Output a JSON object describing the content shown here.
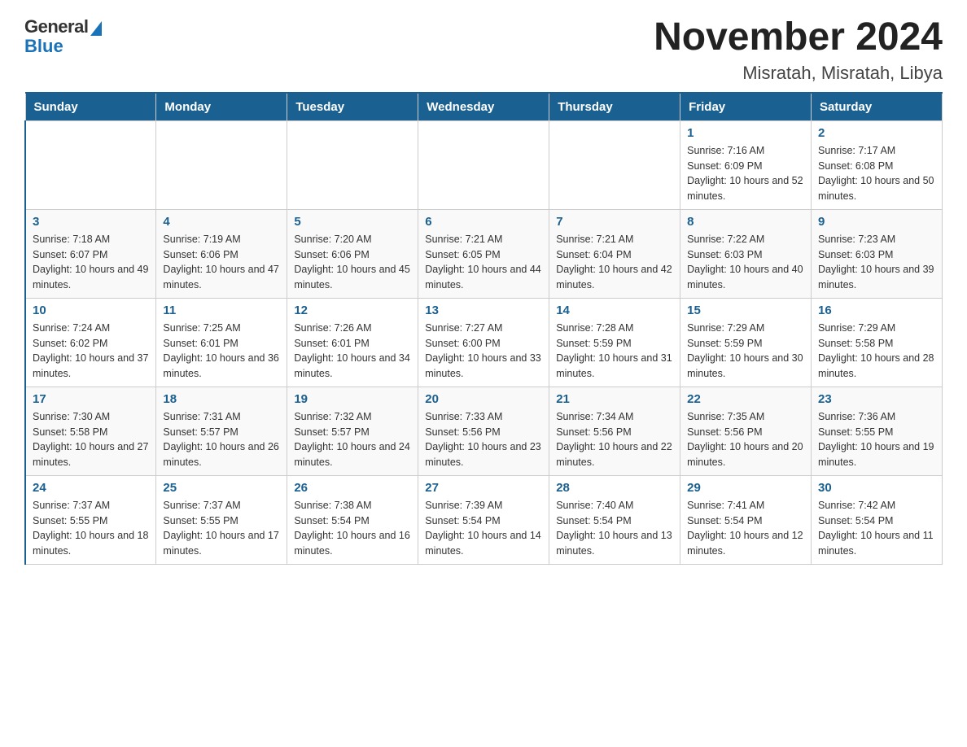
{
  "header": {
    "logo_general": "General",
    "logo_blue": "Blue",
    "month_year": "November 2024",
    "location": "Misratah, Misratah, Libya"
  },
  "days_of_week": [
    "Sunday",
    "Monday",
    "Tuesday",
    "Wednesday",
    "Thursday",
    "Friday",
    "Saturday"
  ],
  "weeks": [
    [
      {
        "day": "",
        "info": ""
      },
      {
        "day": "",
        "info": ""
      },
      {
        "day": "",
        "info": ""
      },
      {
        "day": "",
        "info": ""
      },
      {
        "day": "",
        "info": ""
      },
      {
        "day": "1",
        "info": "Sunrise: 7:16 AM\nSunset: 6:09 PM\nDaylight: 10 hours and 52 minutes."
      },
      {
        "day": "2",
        "info": "Sunrise: 7:17 AM\nSunset: 6:08 PM\nDaylight: 10 hours and 50 minutes."
      }
    ],
    [
      {
        "day": "3",
        "info": "Sunrise: 7:18 AM\nSunset: 6:07 PM\nDaylight: 10 hours and 49 minutes."
      },
      {
        "day": "4",
        "info": "Sunrise: 7:19 AM\nSunset: 6:06 PM\nDaylight: 10 hours and 47 minutes."
      },
      {
        "day": "5",
        "info": "Sunrise: 7:20 AM\nSunset: 6:06 PM\nDaylight: 10 hours and 45 minutes."
      },
      {
        "day": "6",
        "info": "Sunrise: 7:21 AM\nSunset: 6:05 PM\nDaylight: 10 hours and 44 minutes."
      },
      {
        "day": "7",
        "info": "Sunrise: 7:21 AM\nSunset: 6:04 PM\nDaylight: 10 hours and 42 minutes."
      },
      {
        "day": "8",
        "info": "Sunrise: 7:22 AM\nSunset: 6:03 PM\nDaylight: 10 hours and 40 minutes."
      },
      {
        "day": "9",
        "info": "Sunrise: 7:23 AM\nSunset: 6:03 PM\nDaylight: 10 hours and 39 minutes."
      }
    ],
    [
      {
        "day": "10",
        "info": "Sunrise: 7:24 AM\nSunset: 6:02 PM\nDaylight: 10 hours and 37 minutes."
      },
      {
        "day": "11",
        "info": "Sunrise: 7:25 AM\nSunset: 6:01 PM\nDaylight: 10 hours and 36 minutes."
      },
      {
        "day": "12",
        "info": "Sunrise: 7:26 AM\nSunset: 6:01 PM\nDaylight: 10 hours and 34 minutes."
      },
      {
        "day": "13",
        "info": "Sunrise: 7:27 AM\nSunset: 6:00 PM\nDaylight: 10 hours and 33 minutes."
      },
      {
        "day": "14",
        "info": "Sunrise: 7:28 AM\nSunset: 5:59 PM\nDaylight: 10 hours and 31 minutes."
      },
      {
        "day": "15",
        "info": "Sunrise: 7:29 AM\nSunset: 5:59 PM\nDaylight: 10 hours and 30 minutes."
      },
      {
        "day": "16",
        "info": "Sunrise: 7:29 AM\nSunset: 5:58 PM\nDaylight: 10 hours and 28 minutes."
      }
    ],
    [
      {
        "day": "17",
        "info": "Sunrise: 7:30 AM\nSunset: 5:58 PM\nDaylight: 10 hours and 27 minutes."
      },
      {
        "day": "18",
        "info": "Sunrise: 7:31 AM\nSunset: 5:57 PM\nDaylight: 10 hours and 26 minutes."
      },
      {
        "day": "19",
        "info": "Sunrise: 7:32 AM\nSunset: 5:57 PM\nDaylight: 10 hours and 24 minutes."
      },
      {
        "day": "20",
        "info": "Sunrise: 7:33 AM\nSunset: 5:56 PM\nDaylight: 10 hours and 23 minutes."
      },
      {
        "day": "21",
        "info": "Sunrise: 7:34 AM\nSunset: 5:56 PM\nDaylight: 10 hours and 22 minutes."
      },
      {
        "day": "22",
        "info": "Sunrise: 7:35 AM\nSunset: 5:56 PM\nDaylight: 10 hours and 20 minutes."
      },
      {
        "day": "23",
        "info": "Sunrise: 7:36 AM\nSunset: 5:55 PM\nDaylight: 10 hours and 19 minutes."
      }
    ],
    [
      {
        "day": "24",
        "info": "Sunrise: 7:37 AM\nSunset: 5:55 PM\nDaylight: 10 hours and 18 minutes."
      },
      {
        "day": "25",
        "info": "Sunrise: 7:37 AM\nSunset: 5:55 PM\nDaylight: 10 hours and 17 minutes."
      },
      {
        "day": "26",
        "info": "Sunrise: 7:38 AM\nSunset: 5:54 PM\nDaylight: 10 hours and 16 minutes."
      },
      {
        "day": "27",
        "info": "Sunrise: 7:39 AM\nSunset: 5:54 PM\nDaylight: 10 hours and 14 minutes."
      },
      {
        "day": "28",
        "info": "Sunrise: 7:40 AM\nSunset: 5:54 PM\nDaylight: 10 hours and 13 minutes."
      },
      {
        "day": "29",
        "info": "Sunrise: 7:41 AM\nSunset: 5:54 PM\nDaylight: 10 hours and 12 minutes."
      },
      {
        "day": "30",
        "info": "Sunrise: 7:42 AM\nSunset: 5:54 PM\nDaylight: 10 hours and 11 minutes."
      }
    ]
  ]
}
